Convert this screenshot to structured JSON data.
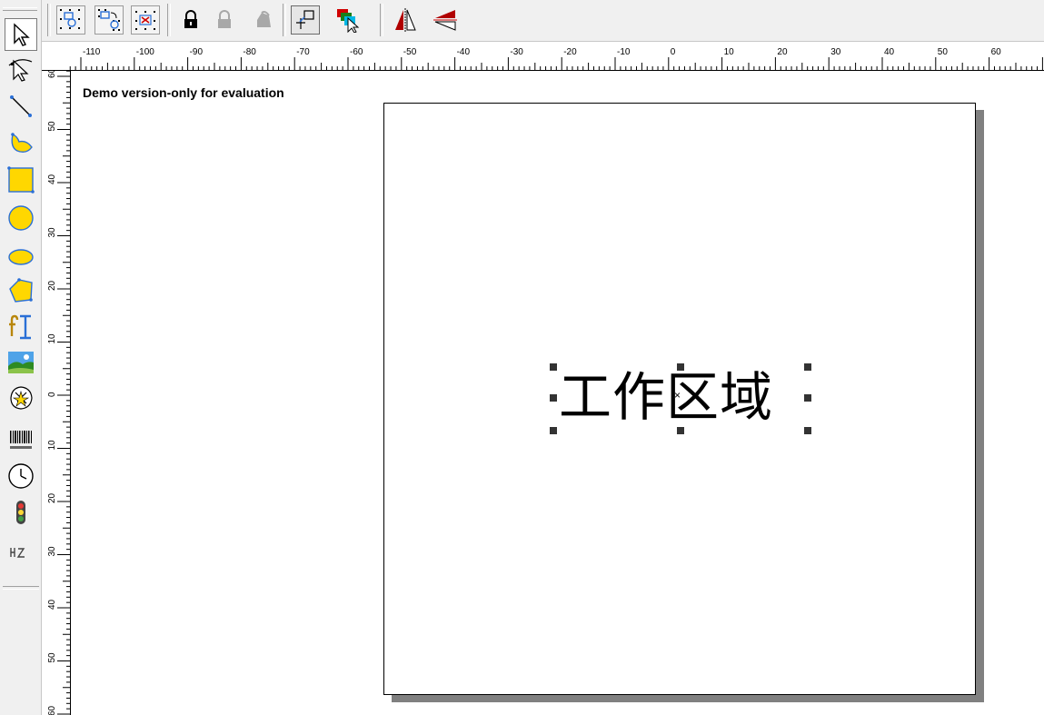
{
  "top_toolbar": {
    "buttons": [
      {
        "name": "group-icon"
      },
      {
        "name": "ungroup-icon"
      },
      {
        "name": "delete-group-icon"
      },
      {
        "name": "lock-icon"
      },
      {
        "name": "lock-disabled-icon"
      },
      {
        "name": "unlock-disabled-icon"
      },
      {
        "name": "origin-point-icon"
      },
      {
        "name": "layer-order-icon"
      },
      {
        "name": "mirror-horizontal-icon"
      },
      {
        "name": "mirror-vertical-icon"
      }
    ]
  },
  "left_toolbar": {
    "tools": [
      {
        "name": "select-arrow-icon",
        "selected": true
      },
      {
        "name": "node-edit-icon"
      },
      {
        "name": "line-icon"
      },
      {
        "name": "curve-icon"
      },
      {
        "name": "rectangle-icon"
      },
      {
        "name": "circle-icon"
      },
      {
        "name": "ellipse-icon"
      },
      {
        "name": "polygon-icon"
      },
      {
        "name": "text-icon"
      },
      {
        "name": "image-icon"
      },
      {
        "name": "vector-import-icon"
      },
      {
        "name": "barcode-icon"
      },
      {
        "name": "clock-icon"
      },
      {
        "name": "io-signal-icon"
      },
      {
        "name": "serial-number-icon"
      }
    ]
  },
  "ruler": {
    "horizontal_labels": [
      "-110",
      "-100",
      "-90",
      "-80",
      "-70",
      "-60",
      "-50",
      "-40",
      "-30",
      "-20",
      "-10",
      "0",
      "10",
      "20",
      "30",
      "40",
      "50",
      "60"
    ],
    "vertical_labels": [
      "60",
      "50",
      "40",
      "30",
      "20",
      "10",
      "0",
      "10",
      "20",
      "30",
      "40",
      "50",
      "60"
    ]
  },
  "canvas": {
    "demo_notice": "Demo version-only for evaluation",
    "text_object": {
      "text": "工作区域"
    }
  },
  "colors": {
    "toolbar_bg": "#f0f0f0",
    "icon_yellow": "#ffd700",
    "icon_blue": "#2a6fd6",
    "icon_red": "#b00000",
    "page_shadow": "#808080"
  }
}
